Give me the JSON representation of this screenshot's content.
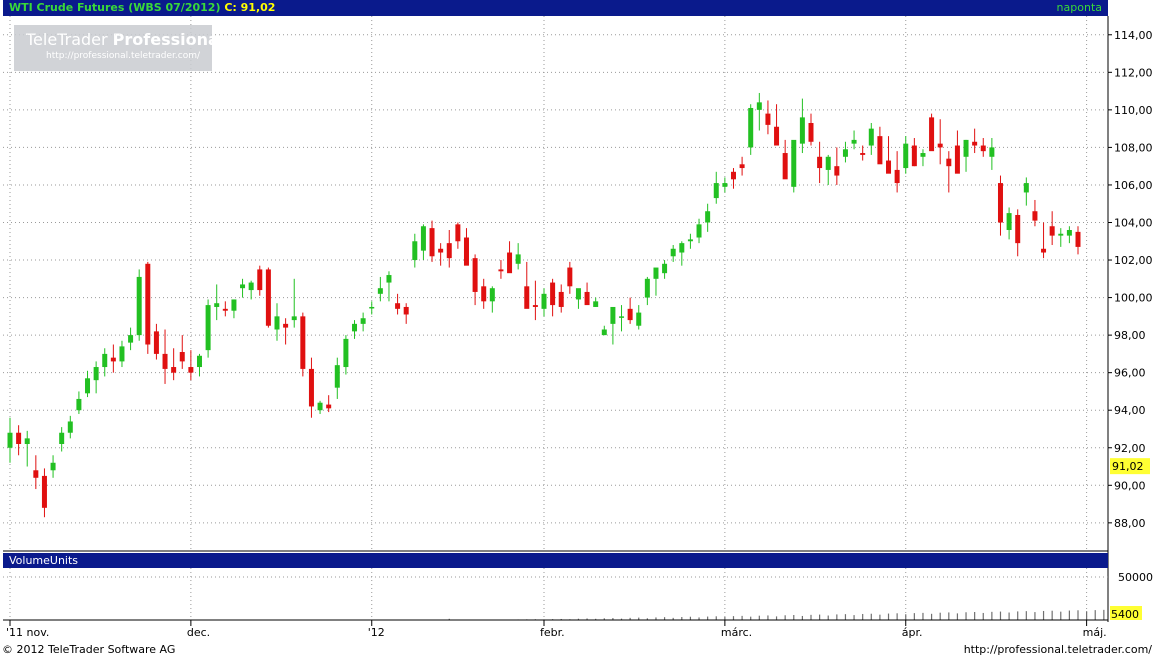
{
  "header": {
    "instrument": "WTI Crude Futures (WBS 07/2012)",
    "close_label": "C:",
    "close_value": "91,02",
    "interval": "naponta"
  },
  "brand": {
    "name_light": "TeleTrader",
    "name_bold": "Professional",
    "url": "http://professional.teletrader.com/"
  },
  "volume_panel": {
    "title": "VolumeUnits",
    "y_ticks": [
      "50000",
      "0"
    ],
    "max_value": 50000,
    "last_value_label": "5400"
  },
  "footer": {
    "copyright": "© 2012 TeleTrader Software AG",
    "url": "http://professional.teletrader.com/"
  },
  "colors": {
    "up": "#22c022",
    "down": "#e01010",
    "panel_header": "#0a1a8c",
    "last_price_bg": "#ffff33"
  },
  "chart_data": {
    "type": "candlestick",
    "price_axis": {
      "ylim": [
        86.5,
        115
      ],
      "ticks": [
        114,
        112,
        110,
        108,
        106,
        104,
        102,
        100,
        98,
        96,
        94,
        92,
        90,
        88
      ],
      "tick_labels": [
        "114,00",
        "112,00",
        "110,00",
        "108,00",
        "106,00",
        "104,00",
        "102,00",
        "100,00",
        "98,00",
        "96,00",
        "94,00",
        "92,00",
        "90,00",
        "88,00"
      ],
      "last_price": 91.02,
      "last_price_label": "91,02"
    },
    "x_axis": {
      "labels": [
        "'11 nov.",
        "dec.",
        "'12",
        "febr.",
        "márc.",
        "ápr.",
        "máj."
      ],
      "label_bar_index": [
        0,
        21,
        42,
        62,
        83,
        104,
        125
      ]
    },
    "ohlc": [
      [
        92.0,
        93.6,
        91.2,
        92.8
      ],
      [
        92.8,
        93.2,
        91.6,
        92.2
      ],
      [
        92.2,
        92.9,
        91.0,
        92.5
      ],
      [
        90.8,
        91.6,
        89.8,
        90.4
      ],
      [
        90.5,
        90.9,
        88.3,
        88.8
      ],
      [
        90.8,
        91.6,
        90.4,
        91.2
      ],
      [
        92.2,
        93.1,
        91.8,
        92.8
      ],
      [
        92.8,
        93.7,
        92.5,
        93.4
      ],
      [
        94.0,
        95.0,
        93.8,
        94.6
      ],
      [
        94.9,
        96.1,
        94.7,
        95.7
      ],
      [
        95.6,
        96.6,
        94.9,
        96.3
      ],
      [
        96.3,
        97.3,
        95.8,
        97.0
      ],
      [
        96.8,
        97.5,
        96.0,
        96.6
      ],
      [
        96.6,
        97.7,
        96.3,
        97.4
      ],
      [
        97.6,
        98.4,
        97.2,
        98.0
      ],
      [
        98.0,
        101.5,
        97.7,
        101.1
      ],
      [
        101.8,
        101.9,
        97.0,
        97.5
      ],
      [
        98.2,
        98.6,
        96.7,
        97.0
      ],
      [
        97.0,
        98.3,
        95.4,
        96.2
      ],
      [
        96.3,
        97.3,
        95.6,
        96.0
      ],
      [
        97.1,
        98.0,
        96.2,
        96.6
      ],
      [
        96.3,
        97.2,
        95.6,
        96.0
      ],
      [
        96.3,
        97.0,
        95.8,
        96.9
      ],
      [
        97.2,
        99.9,
        96.8,
        99.6
      ],
      [
        99.5,
        100.7,
        98.8,
        99.7
      ],
      [
        99.4,
        99.8,
        99.0,
        99.3
      ],
      [
        99.3,
        99.9,
        98.9,
        99.9
      ],
      [
        100.5,
        101.0,
        100.0,
        100.7
      ],
      [
        100.4,
        100.9,
        99.9,
        100.8
      ],
      [
        101.5,
        101.7,
        100.1,
        100.4
      ],
      [
        101.5,
        101.6,
        98.4,
        98.5
      ],
      [
        98.3,
        99.7,
        97.7,
        99.0
      ],
      [
        98.6,
        98.9,
        97.5,
        98.4
      ],
      [
        98.8,
        101.0,
        98.4,
        99.0
      ],
      [
        99.0,
        99.2,
        95.8,
        96.2
      ],
      [
        96.2,
        96.8,
        93.6,
        94.2
      ],
      [
        94.0,
        94.5,
        93.8,
        94.4
      ],
      [
        94.3,
        94.8,
        93.9,
        94.1
      ],
      [
        95.2,
        96.8,
        94.6,
        96.4
      ],
      [
        96.3,
        98.0,
        95.9,
        97.8
      ],
      [
        98.2,
        98.8,
        97.8,
        98.6
      ],
      [
        98.6,
        99.2,
        98.2,
        98.9
      ],
      [
        99.5,
        99.8,
        99.1,
        99.5
      ],
      [
        100.2,
        101.1,
        99.8,
        100.5
      ],
      [
        100.8,
        101.4,
        99.8,
        101.2
      ],
      [
        99.7,
        100.2,
        99.1,
        99.4
      ],
      [
        99.5,
        99.7,
        98.6,
        99.1
      ],
      [
        102.0,
        103.4,
        101.6,
        103.0
      ],
      [
        102.5,
        103.9,
        102.0,
        103.8
      ],
      [
        103.7,
        104.1,
        101.9,
        102.2
      ],
      [
        102.6,
        102.9,
        101.7,
        102.4
      ],
      [
        102.9,
        103.6,
        101.6,
        102.1
      ],
      [
        103.9,
        104.0,
        102.6,
        103.0
      ],
      [
        103.2,
        103.7,
        102.6,
        101.7
      ],
      [
        102.1,
        102.3,
        99.6,
        100.3
      ],
      [
        100.6,
        101.0,
        99.4,
        99.8
      ],
      [
        99.8,
        100.6,
        99.2,
        100.5
      ],
      [
        101.5,
        102.0,
        101.0,
        101.4
      ],
      [
        102.4,
        103.0,
        101.6,
        101.3
      ],
      [
        101.8,
        102.9,
        101.5,
        102.3
      ],
      [
        100.6,
        101.9,
        100.1,
        99.4
      ],
      [
        99.6,
        100.9,
        98.8,
        99.5
      ],
      [
        99.4,
        100.5,
        99.0,
        100.2
      ],
      [
        100.8,
        101.0,
        99.0,
        99.6
      ],
      [
        100.3,
        100.7,
        99.2,
        99.5
      ],
      [
        101.6,
        101.9,
        100.2,
        100.6
      ],
      [
        99.9,
        100.4,
        99.4,
        100.5
      ],
      [
        100.3,
        100.8,
        99.8,
        99.6
      ],
      [
        99.5,
        100.0,
        99.5,
        99.8
      ],
      [
        98.0,
        98.5,
        98.0,
        98.3
      ],
      [
        98.6,
        99.4,
        97.5,
        99.5
      ],
      [
        99.0,
        99.6,
        98.2,
        99.0
      ],
      [
        99.4,
        100.0,
        98.6,
        98.8
      ],
      [
        98.5,
        99.6,
        98.3,
        99.2
      ],
      [
        100.0,
        101.1,
        99.6,
        101.0
      ],
      [
        101.0,
        101.5,
        100.1,
        101.6
      ],
      [
        101.3,
        102.0,
        101.0,
        101.8
      ],
      [
        102.2,
        102.8,
        101.9,
        102.6
      ],
      [
        102.4,
        103.0,
        101.7,
        102.9
      ],
      [
        103.0,
        103.4,
        102.6,
        103.1
      ],
      [
        103.2,
        104.2,
        102.9,
        103.9
      ],
      [
        104.0,
        105.0,
        103.5,
        104.6
      ],
      [
        105.3,
        106.7,
        105.0,
        106.1
      ],
      [
        105.9,
        106.4,
        105.6,
        106.1
      ],
      [
        106.7,
        106.9,
        105.8,
        106.3
      ],
      [
        107.1,
        107.5,
        106.5,
        106.9
      ],
      [
        108.0,
        110.3,
        107.6,
        110.1
      ],
      [
        110.0,
        110.9,
        108.9,
        110.4
      ],
      [
        109.8,
        110.5,
        108.7,
        109.2
      ],
      [
        109.1,
        110.3,
        108.7,
        108.1
      ],
      [
        107.7,
        108.4,
        107.0,
        106.3
      ],
      [
        105.9,
        106.7,
        105.6,
        108.4
      ],
      [
        108.2,
        110.6,
        107.7,
        109.6
      ],
      [
        109.3,
        109.8,
        108.1,
        108.3
      ],
      [
        107.5,
        108.3,
        106.1,
        106.9
      ],
      [
        106.8,
        107.6,
        106.0,
        107.5
      ],
      [
        107.0,
        108.0,
        106.0,
        106.5
      ],
      [
        107.5,
        108.3,
        107.2,
        107.9
      ],
      [
        108.2,
        108.9,
        107.9,
        108.4
      ],
      [
        107.7,
        108.1,
        107.3,
        107.6
      ],
      [
        108.1,
        109.3,
        107.6,
        109.0
      ],
      [
        108.6,
        109.1,
        107.3,
        107.1
      ],
      [
        107.3,
        108.6,
        106.8,
        106.6
      ],
      [
        106.8,
        107.8,
        105.6,
        106.1
      ],
      [
        106.9,
        108.6,
        106.6,
        108.2
      ],
      [
        108.1,
        108.5,
        107.0,
        107.0
      ],
      [
        107.5,
        107.9,
        107.0,
        107.7
      ],
      [
        109.6,
        109.8,
        108.9,
        107.8
      ],
      [
        108.2,
        109.5,
        107.1,
        108.0
      ],
      [
        107.4,
        107.8,
        105.6,
        107.0
      ],
      [
        108.1,
        108.9,
        107.4,
        106.6
      ],
      [
        107.5,
        108.4,
        106.7,
        108.4
      ],
      [
        108.3,
        109.0,
        107.7,
        108.1
      ],
      [
        108.1,
        108.5,
        107.5,
        107.8
      ],
      [
        107.5,
        108.5,
        106.8,
        108.0
      ],
      [
        106.1,
        106.5,
        103.3,
        104.0
      ],
      [
        103.6,
        104.8,
        103.1,
        104.5
      ],
      [
        104.4,
        104.7,
        102.2,
        102.9
      ],
      [
        105.6,
        106.4,
        104.9,
        106.1
      ],
      [
        104.6,
        105.2,
        103.8,
        104.1
      ],
      [
        102.6,
        104.0,
        102.1,
        102.4
      ],
      [
        103.8,
        104.6,
        102.8,
        103.3
      ],
      [
        103.3,
        103.7,
        102.7,
        103.4
      ],
      [
        103.3,
        103.8,
        102.9,
        103.6
      ],
      [
        103.5,
        103.8,
        102.3,
        102.7
      ]
    ],
    "volume": [
      160,
      160,
      160,
      160,
      160,
      160,
      160,
      160,
      160,
      160,
      160,
      160,
      160,
      160,
      220,
      180,
      160,
      180,
      160,
      180,
      160,
      180,
      160,
      180,
      160,
      180,
      160,
      180,
      160,
      180,
      160,
      180,
      160,
      180,
      160,
      180,
      160,
      180,
      160,
      180,
      160,
      180,
      160,
      180,
      160,
      180,
      160,
      180,
      160,
      180,
      160,
      1400,
      200,
      200,
      250,
      300,
      350,
      400,
      500,
      650,
      800,
      900,
      700,
      1000,
      1200,
      900,
      1500,
      1800,
      1400,
      2000,
      2300,
      1600,
      2500,
      2800,
      2000,
      3000,
      3300,
      2500,
      3500,
      3800,
      3000,
      4000,
      4300,
      3500,
      4500,
      4800,
      3900,
      5000,
      5300,
      4200,
      5500,
      5800,
      4700,
      6000,
      6300,
      5200,
      6500,
      6800,
      5700,
      7000,
      7300,
      6200,
      7500,
      7800,
      6700,
      8000,
      8300,
      7200,
      8500,
      8800,
      7700,
      9000,
      9300,
      8200,
      9500,
      9800,
      8700,
      10000,
      10300,
      9200,
      10500,
      10800,
      9700,
      11000,
      11300,
      10200,
      11500,
      11800,
      10700
    ]
  }
}
